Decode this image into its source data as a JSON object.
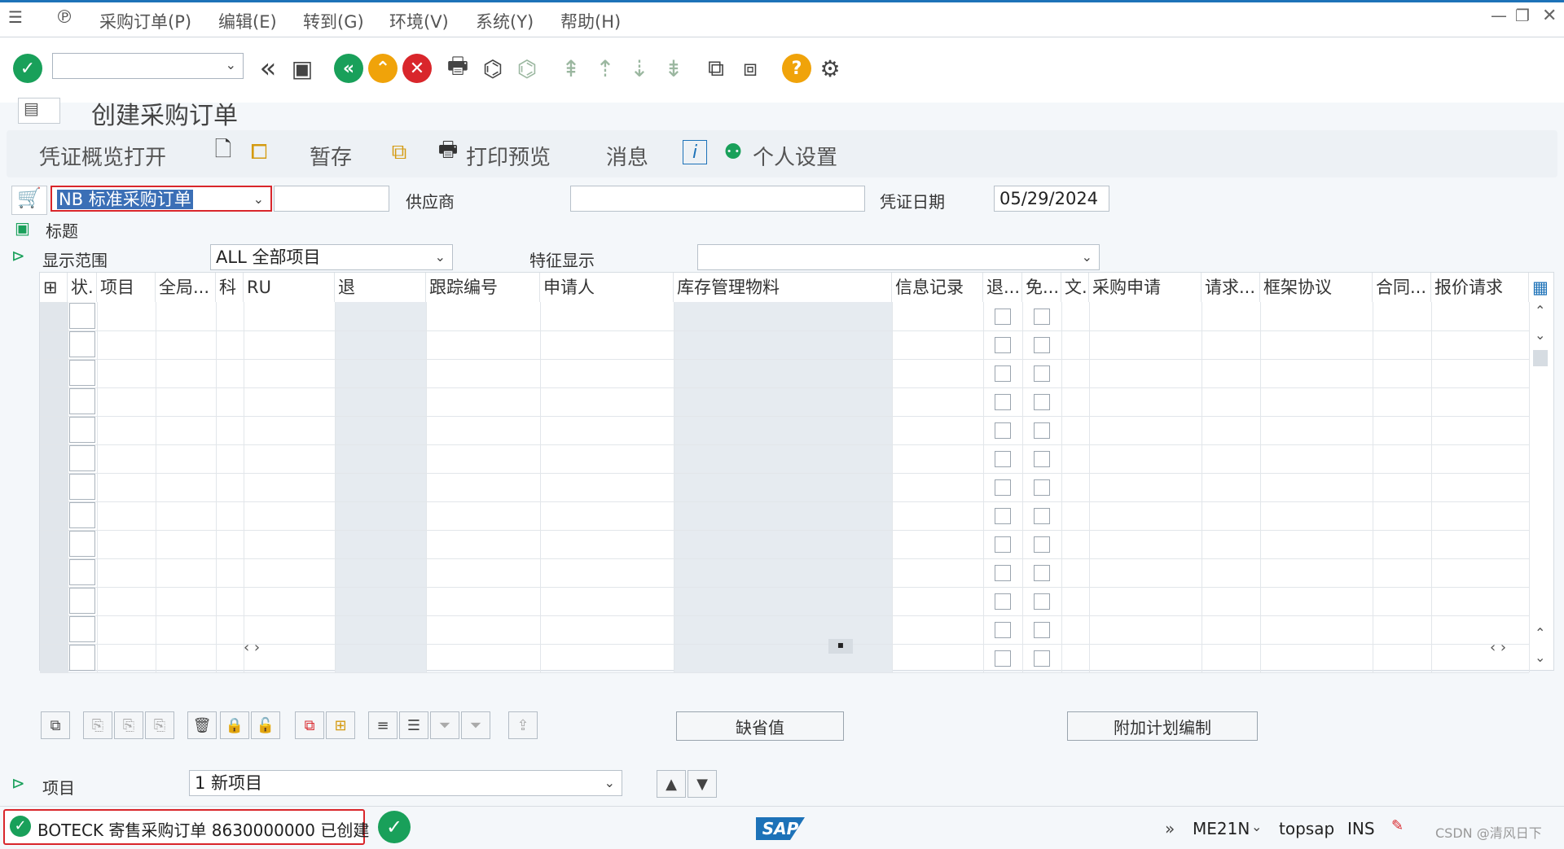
{
  "menubar": {
    "items": [
      "采购订单(P)",
      "编辑(E)",
      "转到(G)",
      "环境(V)",
      "系统(Y)",
      "帮助(H)"
    ]
  },
  "page": {
    "title": "创建采购订单"
  },
  "app_toolbar": {
    "overview": "凭证概览打开",
    "hold": "暂存",
    "print_preview": "打印预览",
    "messages": "消息",
    "personal_settings": "个人设置"
  },
  "header": {
    "order_type": "NB 标准采购订单",
    "supplier_label": "供应商",
    "supplier_value": "",
    "doc_date_label": "凭证日期",
    "doc_date_value": "05/29/2024",
    "title_label": "标题",
    "display_range_label": "显示范围",
    "display_range_value": "ALL 全部项目",
    "feature_label": "特征显示",
    "feature_value": ""
  },
  "table": {
    "columns": [
      "状.",
      "项目",
      "全局...",
      "科",
      "RU",
      "退",
      "跟踪编号",
      "申请人",
      "库存管理物料",
      "信息记录",
      "退...",
      "免...",
      "文.",
      "采购申请",
      "请求...",
      "框架协议",
      "合同...",
      "报价请求"
    ],
    "row_count": 13
  },
  "bottom": {
    "default_values_btn": "缺省值",
    "addl_planning_btn": "附加计划编制",
    "item_label": "项目",
    "item_value": "1 新项目"
  },
  "statusbar": {
    "message": "BOTECK 寄售采购订单 8630000000 已创建",
    "transaction": "ME21N",
    "server": "topsap",
    "mode": "INS",
    "watermark": "CSDN @清风日下"
  },
  "colors": {
    "accent": "#1d72b8",
    "green": "#19a05a",
    "orange": "#f0a30a",
    "red": "#d9262b"
  },
  "icons": [
    "check-icon",
    "back-icon",
    "save-icon",
    "exit-icon",
    "up-icon",
    "cancel-icon",
    "print-icon",
    "find-icon",
    "help-icon",
    "settings-icon",
    "cart-icon",
    "sap-logo"
  ]
}
